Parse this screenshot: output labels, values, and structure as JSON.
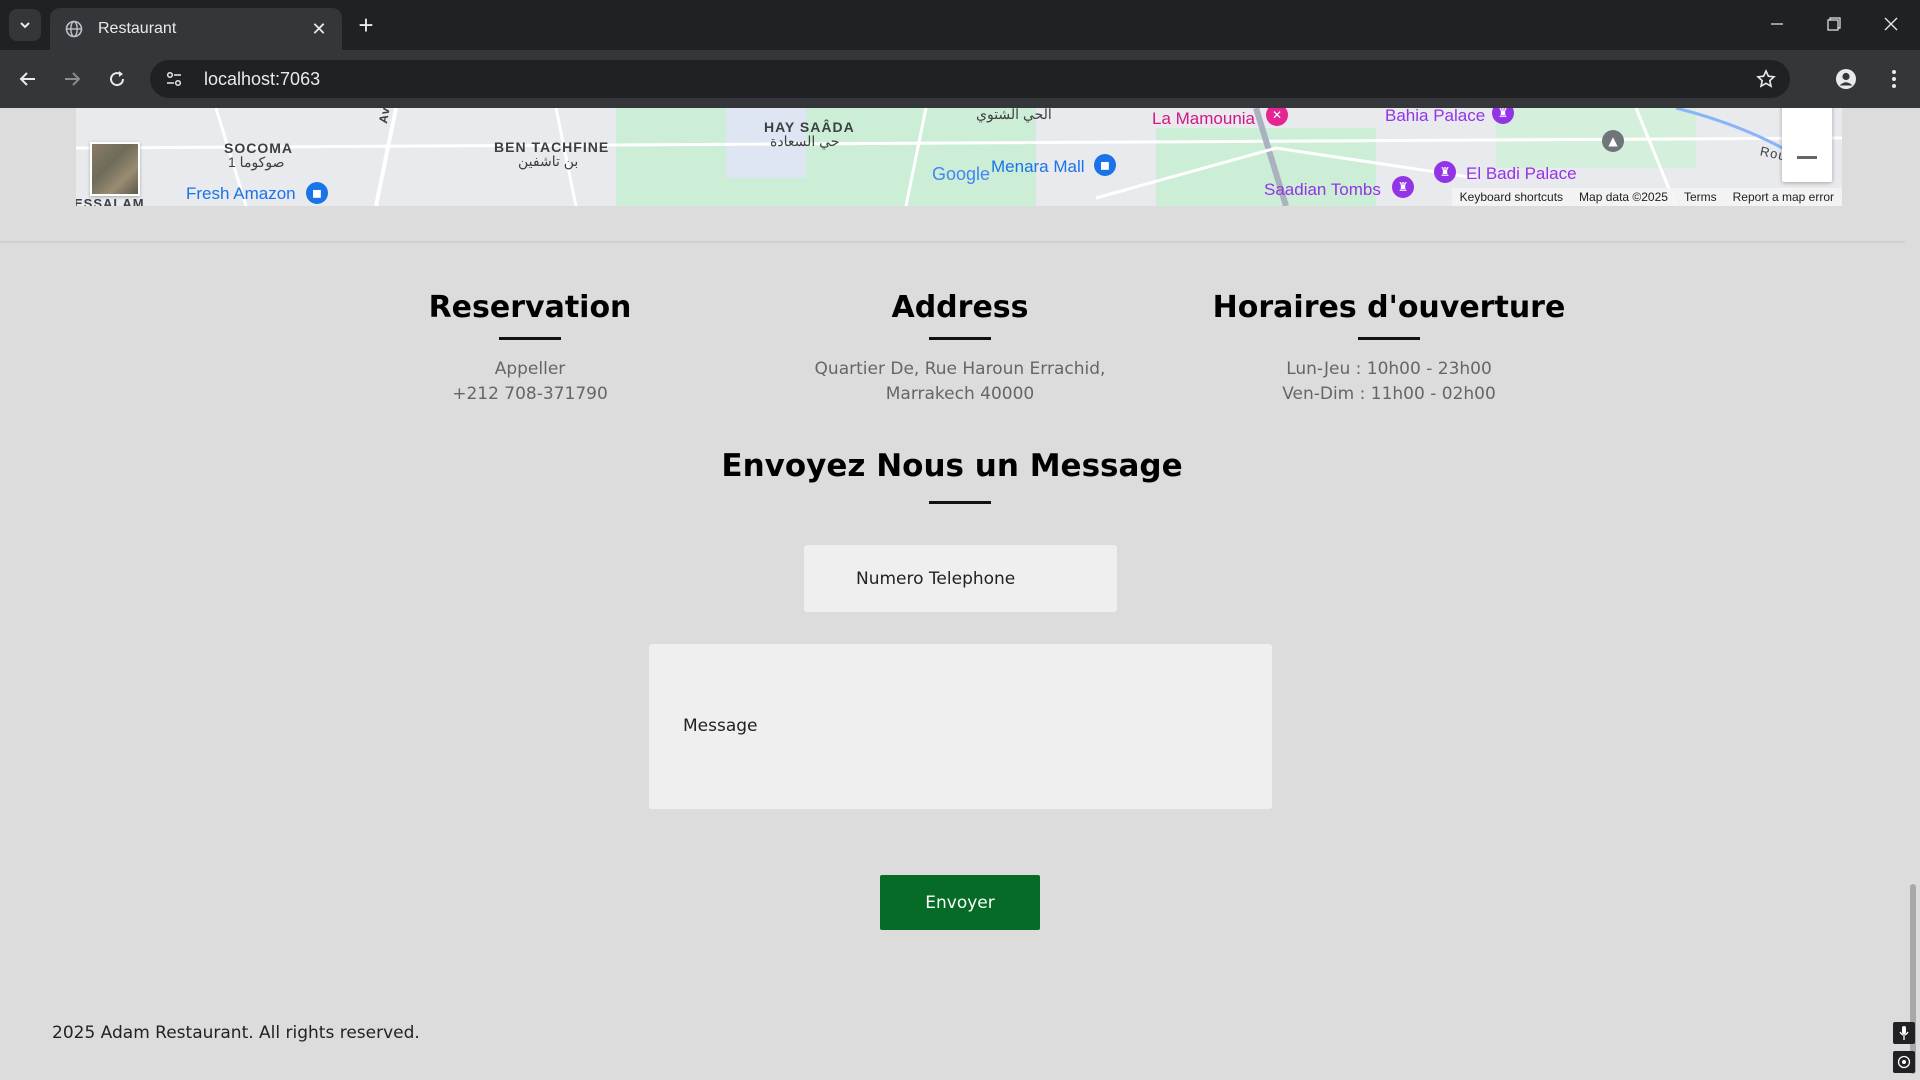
{
  "browser": {
    "tab_title": "Restaurant",
    "url": "localhost:7063",
    "new_tab_symbol": "+",
    "close_symbol": "✕"
  },
  "map": {
    "labels": {
      "socoma": "SOCOMA",
      "socoma_ar": "صوكوما 1",
      "ben_tachfine": "BEN TACHFINE",
      "ben_tachfine_ar": "بن تاشفين",
      "hay_saada": "HAY SAÂDA",
      "hay_saada_ar": "حي السعادة",
      "hay_chetoui_ar": "الحي الشتوي",
      "fresh_amazon": "Fresh Amazon",
      "menara_mall": "Menara Mall",
      "la_mamounia": "La Mamounia",
      "bahia_palace": "Bahia Palace",
      "el_badi_palace": "El Badi Palace",
      "saadian_tombs": "Saadian Tombs",
      "essalam": "ESSALAM",
      "route": "Rou",
      "av": "Av"
    },
    "google_logo": "Google",
    "attribution": {
      "shortcuts": "Keyboard shortcuts",
      "map_data": "Map data ©2025",
      "terms": "Terms",
      "report": "Report a map error"
    }
  },
  "contact": {
    "reservation": {
      "title": "Reservation",
      "line1": "Appeller",
      "line2": "+212 708-371790"
    },
    "address": {
      "title": "Address",
      "line1": "Quartier De, Rue Haroun Errachid,",
      "line2": "Marrakech 40000"
    },
    "hours": {
      "title": "Horaires d'ouverture",
      "line1": "Lun-Jeu : 10h00 - 23h00",
      "line2": "Ven-Dim : 11h00 - 02h00"
    }
  },
  "form": {
    "title": "Envoyez Nous un Message",
    "phone_placeholder": "Numero Telephone",
    "message_placeholder": "Message",
    "submit_label": "Envoyer"
  },
  "footer": {
    "copyright": "2025 Adam Restaurant. All rights reserved."
  },
  "colors": {
    "submit_button": "#056b26",
    "page_background": "#dcdcdc",
    "input_background": "#efefef"
  }
}
